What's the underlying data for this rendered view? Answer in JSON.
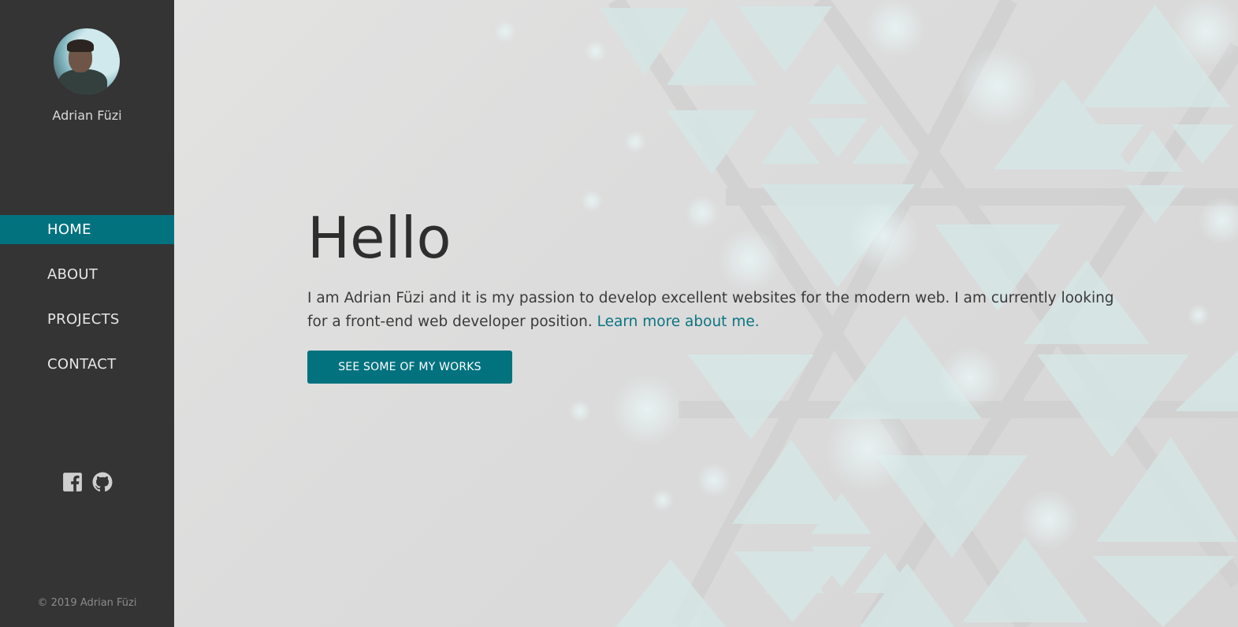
{
  "sidebar": {
    "name": "Adrian Füzi",
    "nav": [
      {
        "label": "HOME",
        "active": true
      },
      {
        "label": "ABOUT",
        "active": false
      },
      {
        "label": "PROJECTS",
        "active": false
      },
      {
        "label": "CONTACT",
        "active": false
      }
    ],
    "social": [
      "facebook-icon",
      "github-icon"
    ],
    "copyright": "© 2019 Adrian Füzi"
  },
  "main": {
    "heading": "Hello",
    "intro_text": "I am Adrian Füzi and it is my passion to develop excellent websites for the modern web. I am currently looking for a front-end web developer position.",
    "intro_link": "Learn more about me.",
    "cta_label": "SEE SOME OF MY WORKS"
  },
  "colors": {
    "sidebar_bg": "#343434",
    "accent": "#03727f",
    "link": "#0b7480"
  }
}
